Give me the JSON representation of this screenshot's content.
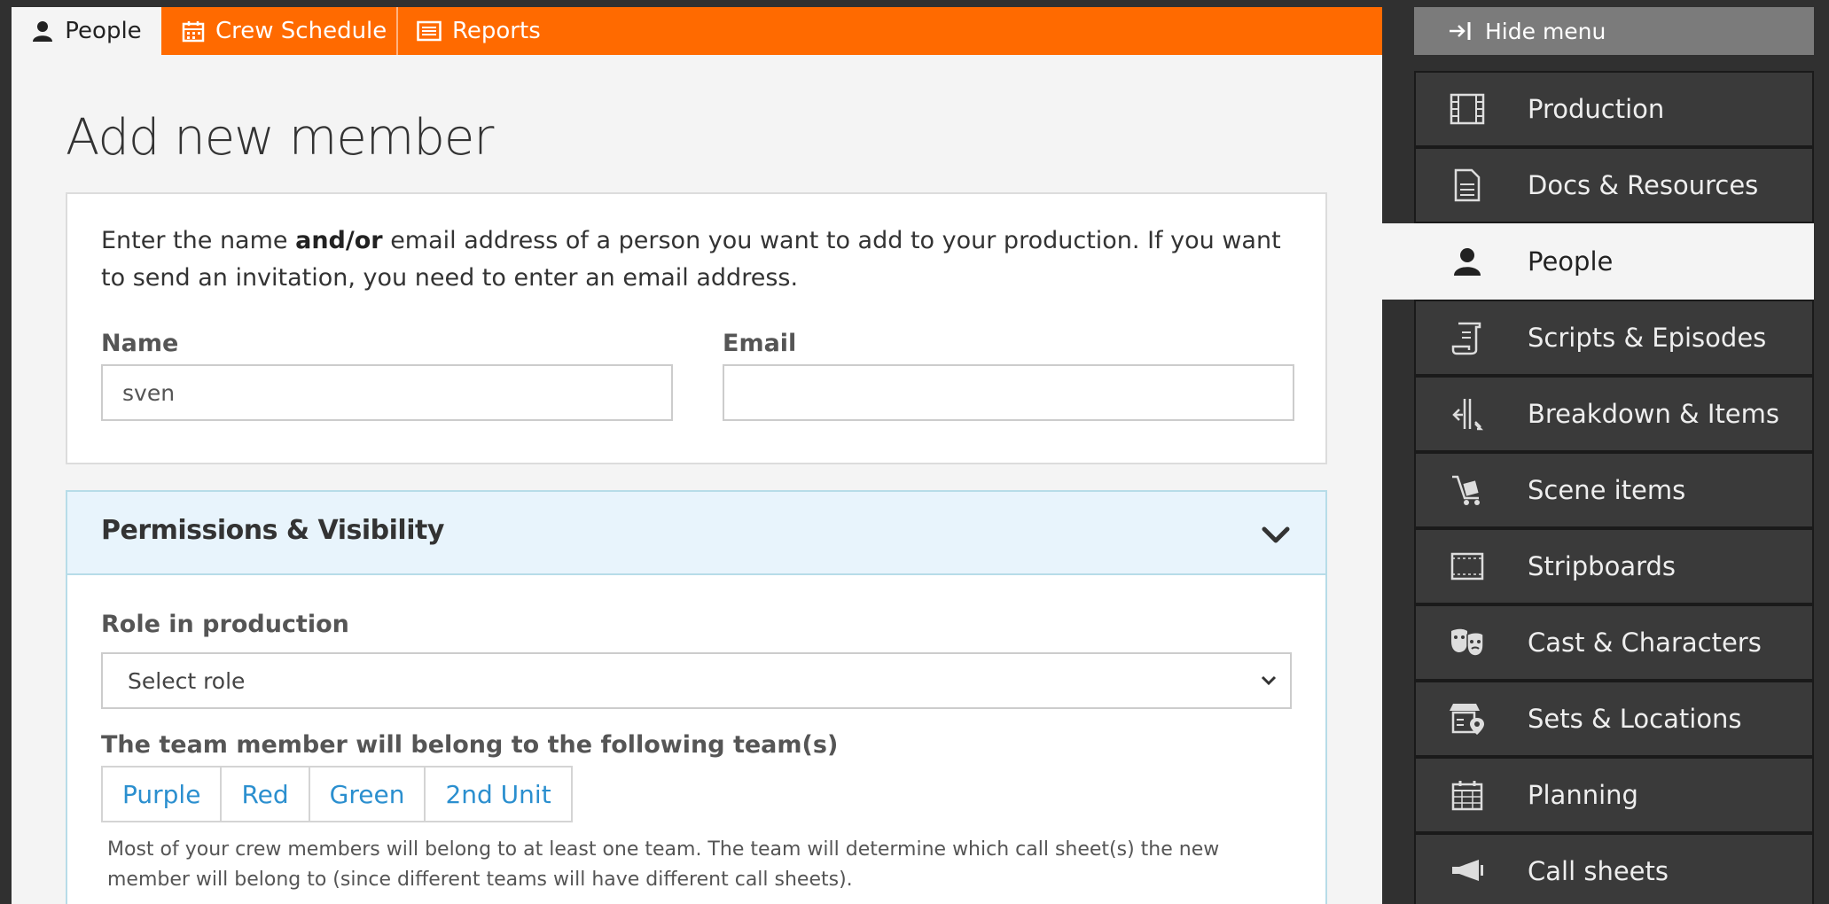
{
  "tabs": [
    {
      "label": "People",
      "icon": "person-icon",
      "active": true
    },
    {
      "label": "Crew Schedule",
      "icon": "calendar-icon",
      "active": false
    },
    {
      "label": "Reports",
      "icon": "list-icon",
      "active": false
    }
  ],
  "page": {
    "title": "Add new member",
    "intro_before": "Enter the name ",
    "intro_bold": "and/or",
    "intro_after": " email address of a person you want to add to your production. If you want to send an invitation, you need to enter an email address.",
    "name_label": "Name",
    "name_value": "sven",
    "email_label": "Email",
    "email_value": ""
  },
  "permissions": {
    "title": "Permissions & Visibility",
    "role_label": "Role in production",
    "role_selected": "Select role",
    "teams_label": "The team member will belong to the following team(s)",
    "teams": [
      "Purple",
      "Red",
      "Green",
      "2nd Unit"
    ],
    "help": "Most of your crew members will belong to at least one team. The team will determine which call sheet(s) the new member will belong to (since different teams will have different call sheets)."
  },
  "sidebar": {
    "hide_label": "Hide menu",
    "items": [
      {
        "label": "Production",
        "icon": "film-icon"
      },
      {
        "label": "Docs & Resources",
        "icon": "document-icon"
      },
      {
        "label": "People",
        "icon": "people-icon",
        "active": true
      },
      {
        "label": "Scripts & Episodes",
        "icon": "script-icon"
      },
      {
        "label": "Breakdown & Items",
        "icon": "breakdown-icon"
      },
      {
        "label": "Scene items",
        "icon": "cart-icon"
      },
      {
        "label": "Stripboards",
        "icon": "stripboard-icon"
      },
      {
        "label": "Cast & Characters",
        "icon": "masks-icon"
      },
      {
        "label": "Sets & Locations",
        "icon": "store-location-icon"
      },
      {
        "label": "Planning",
        "icon": "calendar-icon"
      },
      {
        "label": "Call sheets",
        "icon": "megaphone-icon"
      }
    ]
  },
  "colors": {
    "accent": "#ff6a00",
    "link": "#2b8fcf",
    "sidebar": "#3a3a3a"
  }
}
